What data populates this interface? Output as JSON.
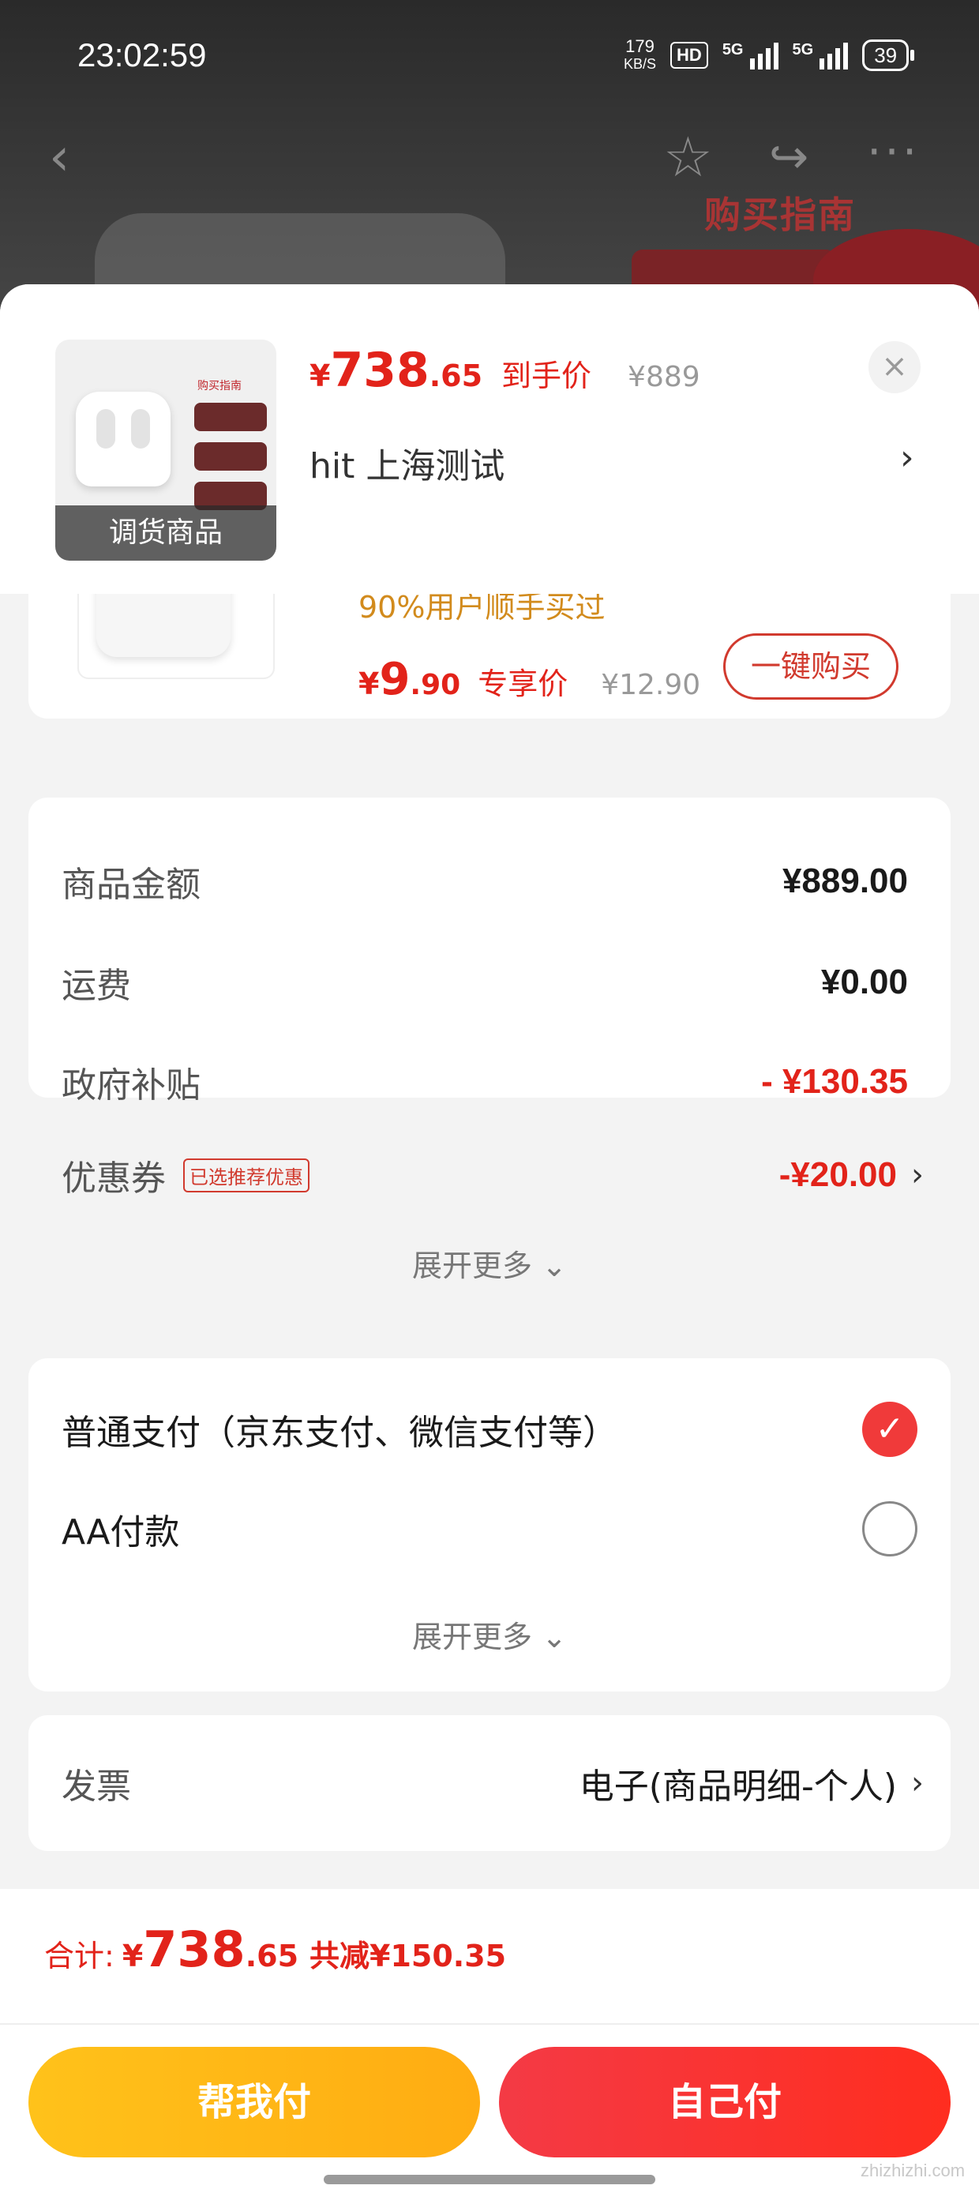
{
  "status_bar": {
    "time": "23:02:59",
    "speed_value": "179",
    "speed_unit": "KB/S",
    "hd": "HD",
    "net1": "5G",
    "net2": "5G",
    "battery": "39"
  },
  "background": {
    "promo_title": "购买指南"
  },
  "header": {
    "thumb_banner": "调货商品",
    "thumb_guide": "购买指南",
    "price_yen": "¥",
    "price_int": "738",
    "price_dec": ".65",
    "price_label": "到手价",
    "orig_price": "¥889",
    "shop_name": "hit  上海测试"
  },
  "recommend": {
    "sold_text": "90%用户顺手买过",
    "price_yen": "¥",
    "price_int": "9",
    "price_dec": ".90",
    "price_label": "专享价",
    "orig_price": "¥12.90",
    "buy_label": "一键购买"
  },
  "amounts": {
    "goods_label": "商品金额",
    "goods_value": "¥889.00",
    "shipping_label": "运费",
    "shipping_value": "¥0.00",
    "subsidy_label": "政府补贴",
    "subsidy_value": "- ¥130.35",
    "coupon_label": "优惠券",
    "coupon_tag": "已选推荐优惠",
    "coupon_value": "-¥20.00",
    "expand": "展开更多"
  },
  "payment": {
    "option1": "普通支付（京东支付、微信支付等）",
    "option2": "AA付款",
    "expand": "展开更多"
  },
  "invoice": {
    "label": "发票",
    "value": "电子(商品明细-个人)"
  },
  "footer": {
    "total_label": "合计:",
    "total_yen": "¥",
    "total_int": "738",
    "total_dec": ".65",
    "saved": "共减¥150.35",
    "help_pay": "帮我付",
    "self_pay": "自己付"
  },
  "watermark": "zhizhizhi.com",
  "colors": {
    "accent": "#e2231a",
    "yellow": "#ffb515",
    "red_btn": "#f43a45"
  }
}
